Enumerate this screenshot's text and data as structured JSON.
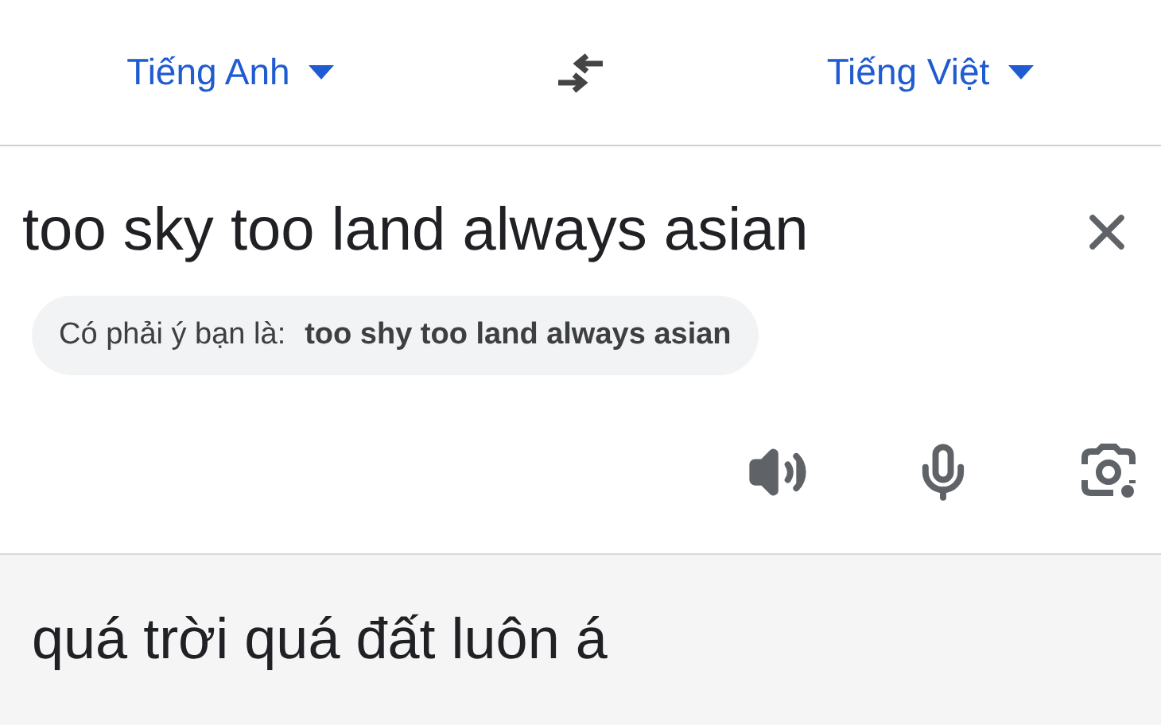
{
  "source_language": {
    "label": "Tiếng Anh"
  },
  "target_language": {
    "label": "Tiếng Việt"
  },
  "input": {
    "value": "too sky too land always asian"
  },
  "suggestion": {
    "prefix": "Có phải ý bạn là:",
    "text": "too shy too land always asian"
  },
  "translation": {
    "text": "quá trời quá đất luôn á"
  }
}
